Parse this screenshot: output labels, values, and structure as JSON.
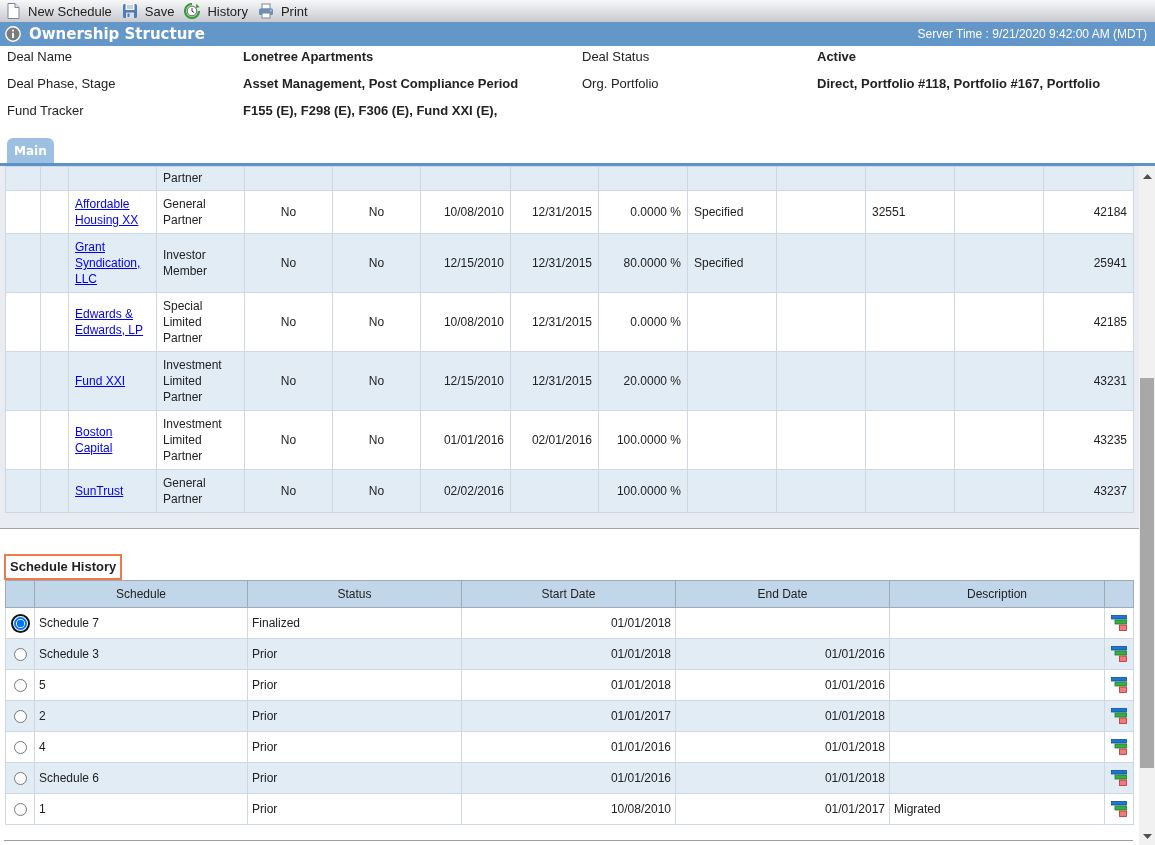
{
  "toolbar": [
    {
      "label": "New Schedule",
      "kind": "new"
    },
    {
      "label": "Save",
      "kind": "save"
    },
    {
      "label": "History",
      "kind": "history"
    },
    {
      "label": "Print",
      "kind": "print"
    }
  ],
  "header": {
    "title": "Ownership Structure",
    "server_time": "Server Time : 9/21/2020 9:42:00 AM (MDT)"
  },
  "deal_info": [
    {
      "label": "Deal Name",
      "value": "Lonetree Apartments"
    },
    {
      "label": "Deal Status",
      "value": "Active"
    },
    {
      "label": "Deal Phase, Stage",
      "value": "Asset Management, Post Compliance Period"
    },
    {
      "label": "Org. Portfolio",
      "value": "Direct, Portfolio #118, Portfolio #167, Portfolio"
    },
    {
      "label": "Fund Tracker",
      "value": "F155 (E), F298 (E), F306 (E), Fund XXI (E),"
    }
  ],
  "tabs": [
    {
      "label": "Main",
      "selected": true
    }
  ],
  "partners_table": {
    "rows": [
      {
        "column_4": "Partner"
      },
      {
        "column_3": "Affordable Housing XX",
        "column_4": "General Partner",
        "column_5": "No",
        "column_6": "No",
        "column_7": "10/08/2010",
        "column_8": "12/31/2015",
        "column_9": "0.0000 %",
        "column_10": "Specified",
        "column_12": "32551",
        "column_14": "42184"
      },
      {
        "column_3": "Grant Syndication, LLC",
        "column_4": "Investor Member",
        "column_5": "No",
        "column_6": "No",
        "column_7": "12/15/2010",
        "column_8": "12/31/2015",
        "column_9": "80.0000 %",
        "column_10": "Specified",
        "column_14": "25941"
      },
      {
        "column_3": "Edwards & Edwards, LP",
        "column_4": "Special Limited Partner",
        "column_5": "No",
        "column_6": "No",
        "column_7": "10/08/2010",
        "column_8": "12/31/2015",
        "column_9": "0.0000 %",
        "column_14": "42185"
      },
      {
        "column_3": "Fund XXI",
        "column_4": "Investment Limited Partner",
        "column_5": "No",
        "column_6": "No",
        "column_7": "12/15/2010",
        "column_8": "12/31/2015",
        "column_9": "20.0000 %",
        "column_14": "43231"
      },
      {
        "column_3": "Boston Capital",
        "column_4": "Investment Limited Partner",
        "column_5": "No",
        "column_6": "No",
        "column_7": "01/01/2016",
        "column_8": "02/01/2016",
        "column_9": "100.0000 %",
        "column_14": "43235"
      },
      {
        "column_3": "SunTrust",
        "column_4": "General Partner",
        "column_5": "No",
        "column_6": "No",
        "column_7": "02/02/2016",
        "column_9": "100.0000 %",
        "column_14": "43237"
      }
    ]
  },
  "schedule_history": {
    "title": "Schedule History",
    "columns": [
      "Schedule",
      "Status",
      "Start Date",
      "End Date",
      "Description"
    ],
    "rows": [
      {
        "selected": true,
        "schedule": "Schedule 7",
        "status": "Finalized",
        "start_date": "01/01/2018"
      },
      {
        "selected": false,
        "schedule": "Schedule 3",
        "status": "Prior",
        "start_date": "01/01/2018",
        "end_date": "01/01/2016"
      },
      {
        "selected": false,
        "schedule": "5",
        "status": "Prior",
        "start_date": "01/01/2018",
        "end_date": "01/01/2016"
      },
      {
        "selected": false,
        "schedule": "2",
        "status": "Prior",
        "start_date": "01/01/2017",
        "end_date": "01/01/2018"
      },
      {
        "selected": false,
        "schedule": "4",
        "status": "Prior",
        "start_date": "01/01/2016",
        "end_date": "01/01/2018"
      },
      {
        "selected": false,
        "schedule": "Schedule 6",
        "status": "Prior",
        "start_date": "01/01/2016",
        "end_date": "01/01/2018"
      },
      {
        "selected": false,
        "schedule": "1",
        "status": "Prior",
        "start_date": "10/08/2010",
        "end_date": "01/01/2017",
        "description": "Migrated"
      }
    ]
  }
}
